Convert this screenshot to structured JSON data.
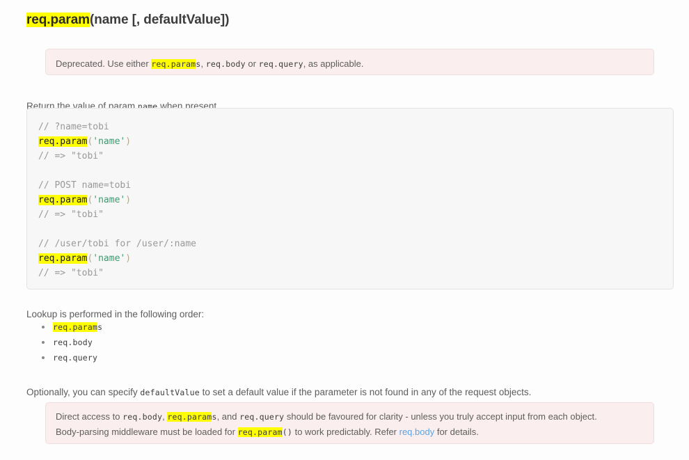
{
  "heading": {
    "name": "req.param",
    "args": "(name [, defaultValue])"
  },
  "deprecated_note": {
    "prefix": "Deprecated. Use either ",
    "code_1_hl": "req.param",
    "code_1_tail": "s",
    "sep_1": ", ",
    "code_2": "req.body",
    "sep_2": " or ",
    "code_3": "req.query",
    "suffix": ", as applicable."
  },
  "return_paragraph": {
    "prefix": "Return the value of param ",
    "code": "name",
    "suffix": " when present."
  },
  "code_block": {
    "blocks": [
      {
        "comment_top": "// ?name=tobi",
        "call_name": "req.param",
        "open_paren": "(",
        "string_arg": "'name'",
        "close_paren": ")",
        "comment_bottom": "// => \"tobi\""
      },
      {
        "comment_top": "// POST name=tobi",
        "call_name": "req.param",
        "open_paren": "(",
        "string_arg": "'name'",
        "close_paren": ")",
        "comment_bottom": "// => \"tobi\""
      },
      {
        "comment_top": "// /user/tobi for /user/:name",
        "call_name": "req.param",
        "open_paren": "(",
        "string_arg": "'name'",
        "close_paren": ")",
        "comment_bottom": "// => \"tobi\""
      }
    ]
  },
  "lookup_paragraph": "Lookup is performed in the following order:",
  "lookup_list": [
    {
      "hl": "req.param",
      "tail": "s"
    },
    {
      "hl": "",
      "tail": "req.body"
    },
    {
      "hl": "",
      "tail": "req.query"
    }
  ],
  "optional_paragraph": {
    "prefix": "Optionally, you can specify ",
    "code": "defaultValue",
    "suffix": " to set a default value if the parameter is not found in any of the request objects."
  },
  "direct_access_note": {
    "line1": {
      "prefix": "Direct access to ",
      "code_1": "req.body",
      "sep_1": ", ",
      "code_2_hl": "req.param",
      "code_2_tail": "s",
      "sep_2": ", and ",
      "code_3": "req.query",
      "suffix": " should be favoured for clarity - unless you truly accept input from each object."
    },
    "line2": {
      "prefix": "Body-parsing middleware must be loaded for ",
      "code_hl": "req.param",
      "code_tail": "()",
      "mid": " to work predictably. Refer ",
      "link": "req.body",
      "suffix": " for details."
    }
  },
  "colors": {
    "highlight": "#ffff00",
    "note_bg": "#fbeeee",
    "note_border": "#f0dede",
    "code_bg": "#f7f7f7",
    "code_border": "#e3e3e3",
    "link": "#5ba4e5",
    "comment": "#999999",
    "string": "#3d9970",
    "text": "#5d5d5d"
  }
}
